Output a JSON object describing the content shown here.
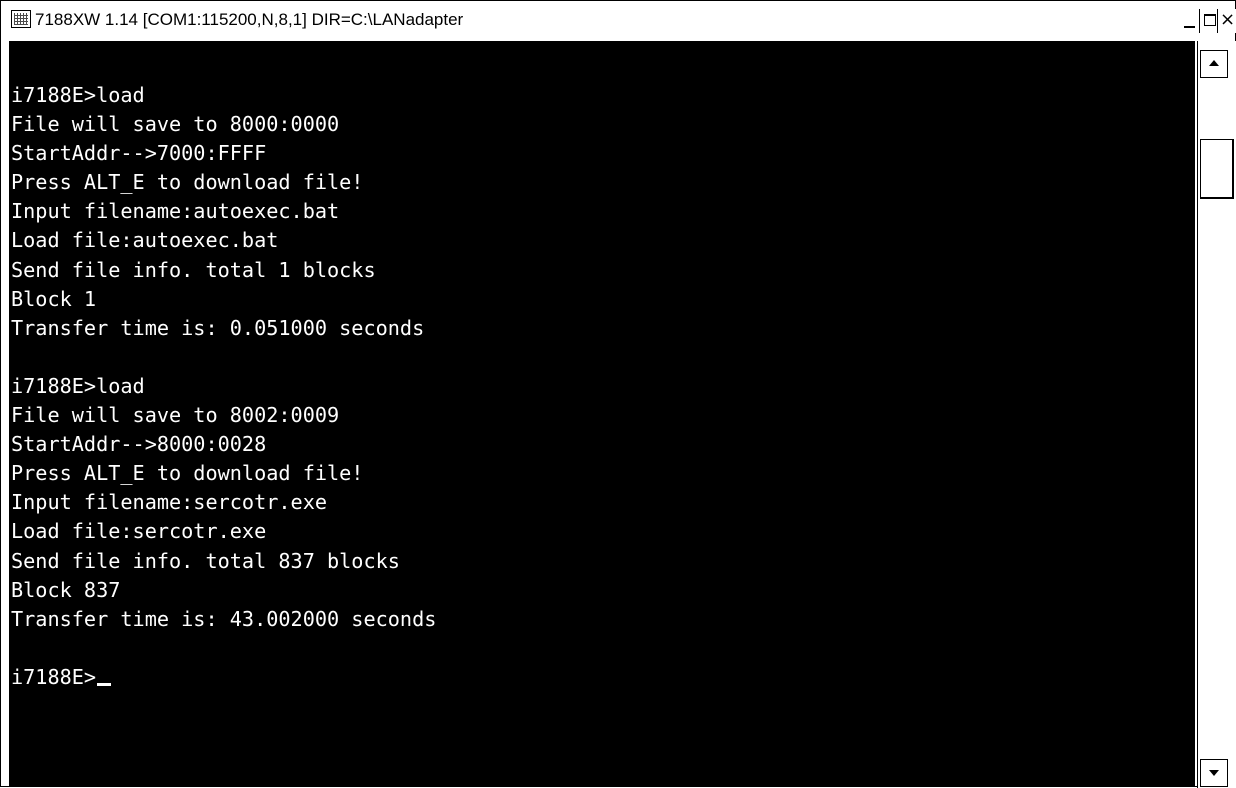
{
  "window": {
    "title": "7188XW 1.14 [COM1:115200,N,8,1] DIR=C:\\LANadapter",
    "icon": "terminal-app-icon",
    "controls": {
      "minimize": "minimize-icon",
      "maximize": "maximize-icon",
      "close_glyph": "×"
    }
  },
  "terminal": {
    "lines": [
      "i7188E>load",
      "File will save to 8000:0000",
      "StartAddr-->7000:FFFF",
      "Press ALT_E to download file!",
      "Input filename:autoexec.bat",
      "Load file:autoexec.bat",
      "Send file info. total 1 blocks",
      "Block 1",
      "Transfer time is: 0.051000 seconds",
      "",
      "i7188E>load",
      "File will save to 8002:0009",
      "StartAddr-->8000:0028",
      "Press ALT_E to download file!",
      "Input filename:sercotr.exe",
      "Load file:sercotr.exe",
      "Send file info. total 837 blocks",
      "Block 837",
      "Transfer time is: 43.002000 seconds",
      "",
      "i7188E>"
    ],
    "colors": {
      "background": "#000000",
      "text": "#ffffff"
    }
  },
  "scrollbar": {
    "up_icon": "scroll-up-arrow-icon",
    "down_icon": "scroll-down-arrow-icon"
  }
}
